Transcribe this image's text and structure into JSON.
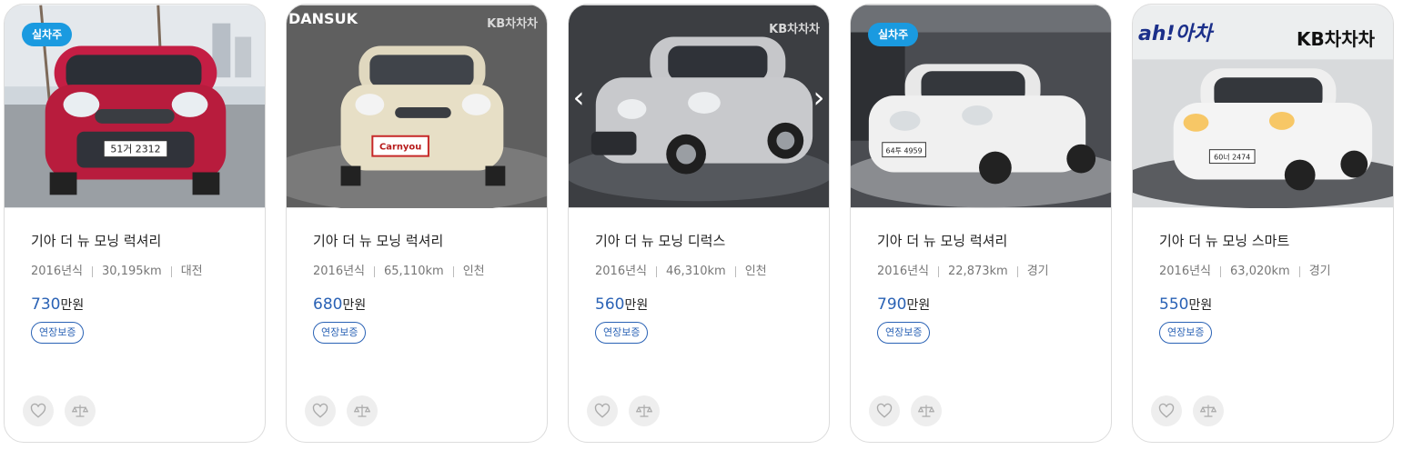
{
  "cards": [
    {
      "title": "기아 더 뉴 모닝 럭셔리",
      "year": "2016년식",
      "mileage": "30,195km",
      "region": "대전",
      "price_num": "730",
      "price_unit": "만원",
      "tag": "연장보증",
      "badge": "실차주",
      "car_color": "#b0203f",
      "logo_left": "",
      "logo_right": "",
      "plate": "51거 2312"
    },
    {
      "title": "기아 더 뉴 모닝 럭셔리",
      "year": "2016년식",
      "mileage": "65,110km",
      "region": "인천",
      "price_num": "680",
      "price_unit": "만원",
      "tag": "연장보증",
      "badge": "",
      "car_color": "#e7dfc6",
      "logo_left": "DANSUK",
      "logo_right": "KB차차차",
      "plate": "Carnyou"
    },
    {
      "title": "기아 더 뉴 모닝 디럭스",
      "year": "2016년식",
      "mileage": "46,310km",
      "region": "인천",
      "price_num": "560",
      "price_unit": "만원",
      "tag": "연장보증",
      "badge": "",
      "car_color": "#c8c9cc",
      "logo_left": "",
      "logo_right": "KB차차차",
      "plate": ""
    },
    {
      "title": "기아 더 뉴 모닝 럭셔리",
      "year": "2016년식",
      "mileage": "22,873km",
      "region": "경기",
      "price_num": "790",
      "price_unit": "만원",
      "tag": "연장보증",
      "badge": "실차주",
      "car_color": "#f0f0f0",
      "logo_left": "",
      "logo_right": "",
      "plate": "64투 4959"
    },
    {
      "title": "기아 더 뉴 모닝 스마트",
      "year": "2016년식",
      "mileage": "63,020km",
      "region": "경기",
      "price_num": "550",
      "price_unit": "만원",
      "tag": "연장보증",
      "badge": "",
      "car_color": "#f4f4f4",
      "logo_left": "ah!아차",
      "logo_right": "KB차차차",
      "plate": "60너 2474"
    }
  ],
  "icons": {
    "like": "heart-icon",
    "compare": "scale-icon",
    "prev": "chevron-left-icon",
    "next": "chevron-right-icon"
  },
  "colors": {
    "accent": "#2a62b5",
    "badge": "#1a9ae0"
  }
}
